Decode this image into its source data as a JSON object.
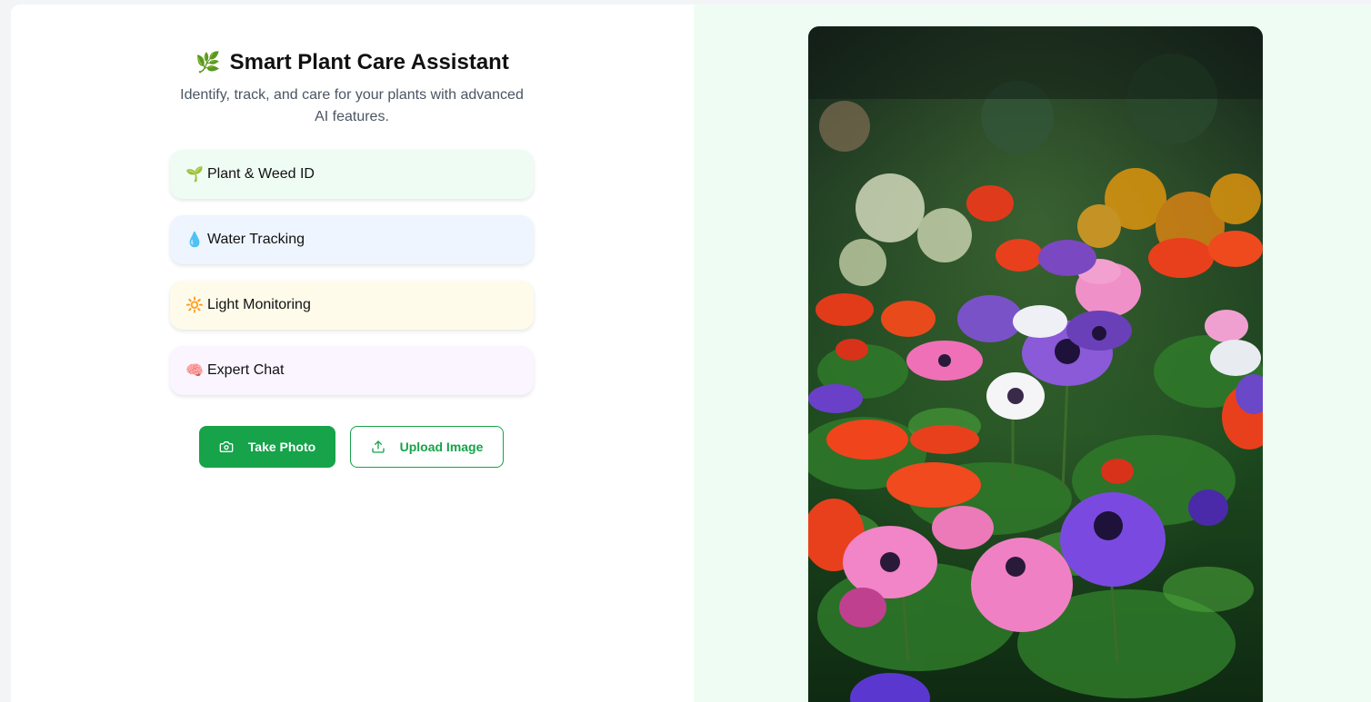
{
  "header": {
    "title_icon": "🌿",
    "title": "Smart Plant Care Assistant",
    "subtitle": "Identify, track, and care for your plants with advanced AI features."
  },
  "features": [
    {
      "icon": "🌱",
      "label": "Plant & Weed ID"
    },
    {
      "icon": "💧",
      "label": "Water Tracking"
    },
    {
      "icon": "🔆",
      "label": "Light Monitoring"
    },
    {
      "icon": "🧠",
      "label": "Expert Chat"
    }
  ],
  "actions": {
    "take_photo": "Take Photo",
    "upload_image": "Upload Image"
  },
  "icons": {
    "camera": "camera-icon",
    "upload": "upload-icon"
  },
  "colors": {
    "accent": "#16a34a",
    "right_bg": "#effcf3"
  }
}
